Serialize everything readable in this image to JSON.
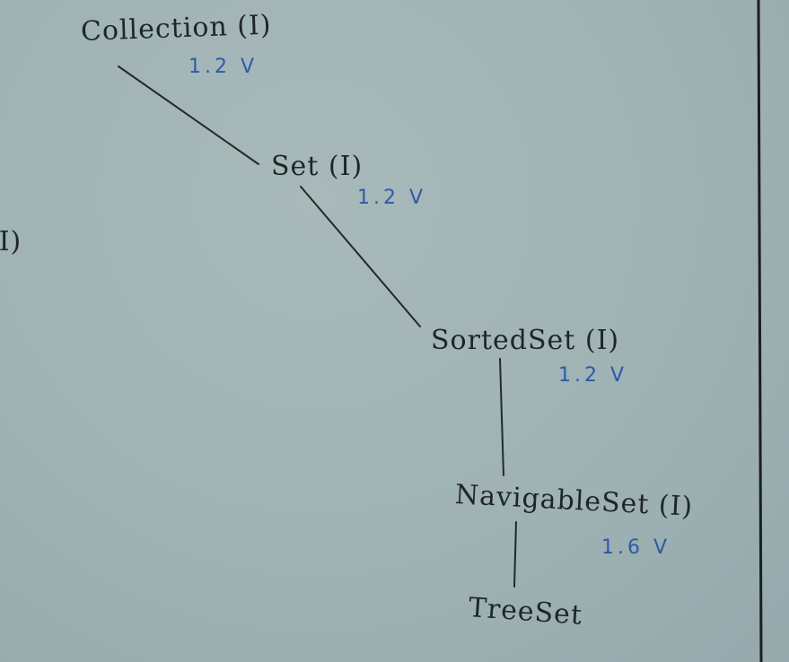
{
  "diagram": {
    "nodes": [
      {
        "id": "collection",
        "label": "Collection (I)",
        "version": "1.2 V"
      },
      {
        "id": "set",
        "label": "Set (I)",
        "version": "1.2 V"
      },
      {
        "id": "sortedset",
        "label": "SortedSet (I)",
        "version": "1.2 V"
      },
      {
        "id": "navigableset",
        "label": "NavigableSet (I)",
        "version": "1.6 V"
      },
      {
        "id": "treeset",
        "label": "TreeSet",
        "version": ""
      }
    ],
    "edges": [
      {
        "from": "collection",
        "to": "set"
      },
      {
        "from": "set",
        "to": "sortedset"
      },
      {
        "from": "sortedset",
        "to": "navigableset"
      },
      {
        "from": "navigableset",
        "to": "treeset"
      }
    ],
    "partial_left_label": "(I)"
  },
  "colors": {
    "board": "#a3b5b7",
    "ink": "#1f2628",
    "version_ink": "#2e5aa8"
  }
}
